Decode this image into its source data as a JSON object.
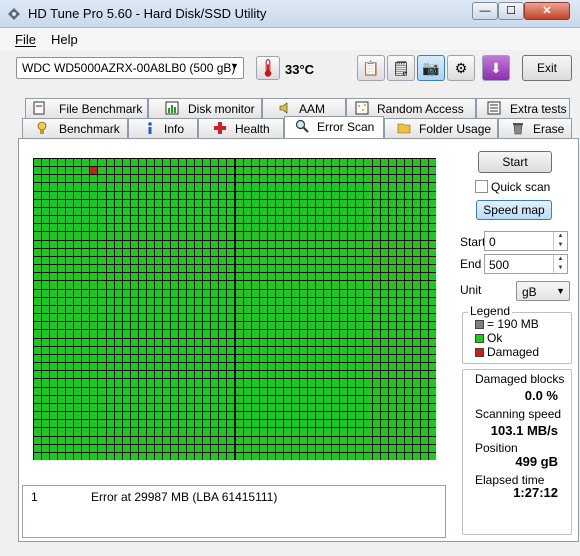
{
  "window": {
    "title": "HD Tune Pro 5.60 - Hard Disk/SSD Utility",
    "minimize_icon": "minimize-icon",
    "maximize_icon": "maximize-icon",
    "close_icon": "close-icon",
    "close_label": "✕",
    "minimize_label": "—",
    "maximize_label": "☐"
  },
  "menu": {
    "file": "File",
    "help": "Help"
  },
  "toolbar": {
    "drive": "WDC WD5000AZRX-00A8LB0 (500 gB)",
    "temperature": "33°C",
    "exit_label": "Exit"
  },
  "tabs_row1": [
    {
      "label": "File Benchmark",
      "icon": "file-benchmark-icon"
    },
    {
      "label": "Disk monitor",
      "icon": "disk-monitor-icon"
    },
    {
      "label": "AAM",
      "icon": "speaker-icon"
    },
    {
      "label": "Random Access",
      "icon": "random-access-icon"
    },
    {
      "label": "Extra tests",
      "icon": "extra-tests-icon"
    }
  ],
  "tabs_row2": [
    {
      "label": "Benchmark",
      "icon": "benchmark-icon"
    },
    {
      "label": "Info",
      "icon": "info-icon"
    },
    {
      "label": "Health",
      "icon": "health-cross-icon"
    },
    {
      "label": "Error Scan",
      "icon": "magnifier-icon",
      "active": true
    },
    {
      "label": "Folder Usage",
      "icon": "folder-icon"
    },
    {
      "label": "Erase",
      "icon": "trash-icon"
    }
  ],
  "scan_grid": {
    "colors": {
      "ok": "#1ec81e",
      "damaged": "#c81e1e",
      "lines": "#0a0a0a"
    },
    "damaged_blocks": [
      {
        "row": 1,
        "col": 7
      }
    ]
  },
  "log": [
    {
      "index": "1",
      "message": "Error at 29987 MB (LBA 61415111)"
    }
  ],
  "controls": {
    "start_label": "Start",
    "quick_scan_label": "Quick scan",
    "quick_scan_checked": false,
    "speed_map_label": "Speed map",
    "start_field_label": "Start",
    "start_value": "0",
    "end_field_label": "End",
    "end_value": "500",
    "unit_label": "Unit",
    "unit_value": "gB"
  },
  "legend": {
    "title": "Legend",
    "items": [
      {
        "label": "= 190 MB",
        "color": "#808080"
      },
      {
        "label": "Ok",
        "color": "#1ec81e"
      },
      {
        "label": "Damaged",
        "color": "#c81e1e"
      }
    ]
  },
  "stats": {
    "damaged_blocks_label": "Damaged blocks",
    "damaged_blocks_value": "0.0 %",
    "scanning_speed_label": "Scanning speed",
    "scanning_speed_value": "103.1 MB/s",
    "position_label": "Position",
    "position_value": "499 gB",
    "elapsed_label": "Elapsed time",
    "elapsed_value": "1:27:12"
  }
}
